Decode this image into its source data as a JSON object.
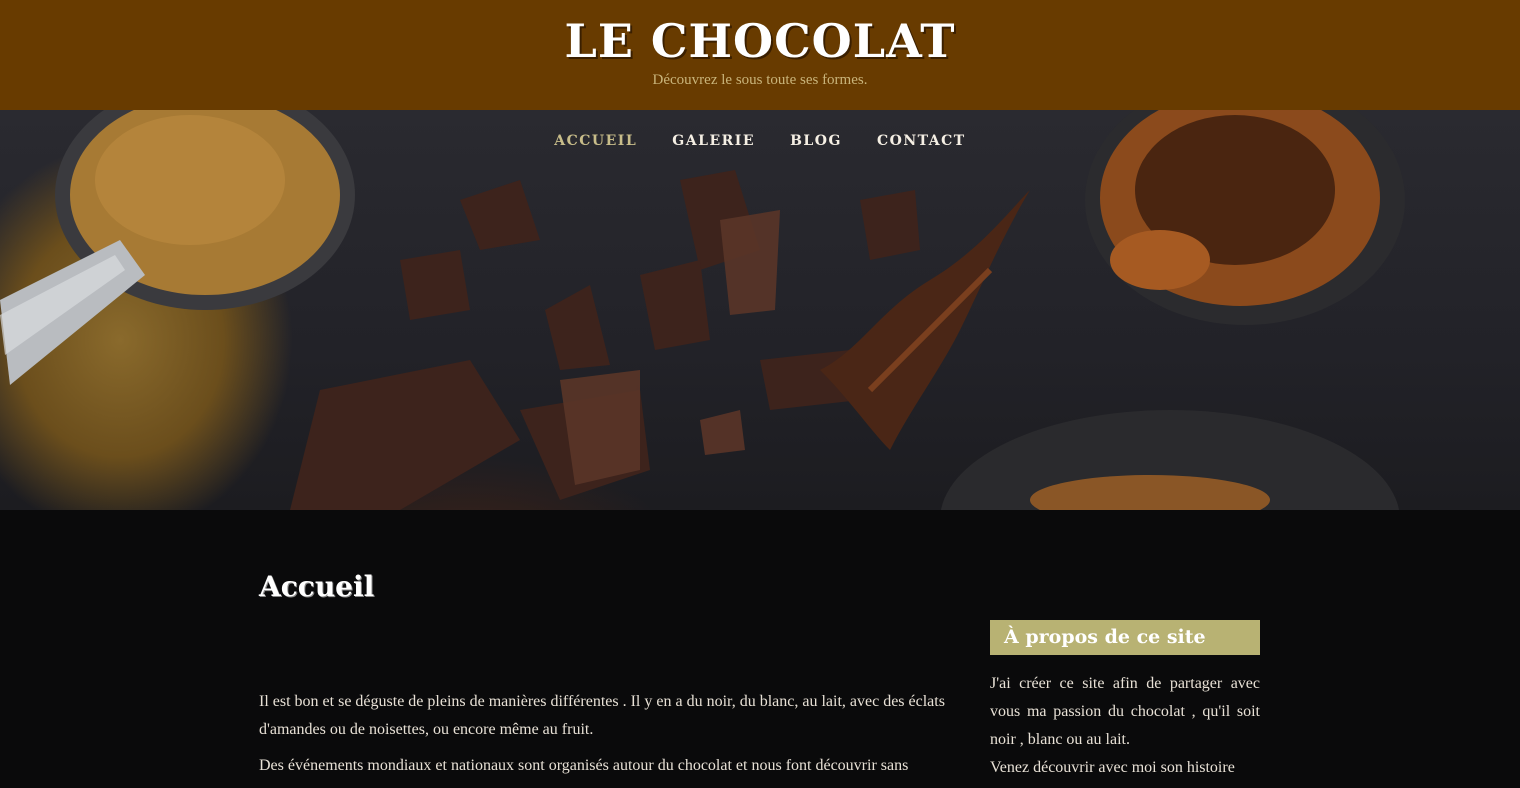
{
  "header": {
    "site_title": "LE CHOCOLAT",
    "tagline": "Découvrez le sous toute ses formes."
  },
  "nav": {
    "items": [
      {
        "label": "ACCUEIL",
        "active": true
      },
      {
        "label": "GALERIE",
        "active": false
      },
      {
        "label": "BLOG",
        "active": false
      },
      {
        "label": "CONTACT",
        "active": false
      }
    ]
  },
  "main": {
    "page_title": "Accueil",
    "paragraphs": [
      "Il est bon et se déguste de pleins de manières différentes . Il y en a du noir, du blanc, au lait, avec des éclats d'amandes ou de noisettes, ou encore même au fruit.",
      "Des événements mondiaux et nationaux sont organisés autour du chocolat et nous font découvrir sans"
    ]
  },
  "sidebar": {
    "widget_title": "À propos de ce site",
    "paragraphs": [
      "J'ai créer ce site afin de partager avec vous ma passion du chocolat , qu'il soit noir , blanc ou au lait.",
      "Venez découvrir avec moi son histoire"
    ]
  },
  "colors": {
    "header_bg": "#683b00",
    "accent": "#b8b273",
    "nav_active": "#c8bd8a",
    "content_bg": "#0a0a0b"
  }
}
